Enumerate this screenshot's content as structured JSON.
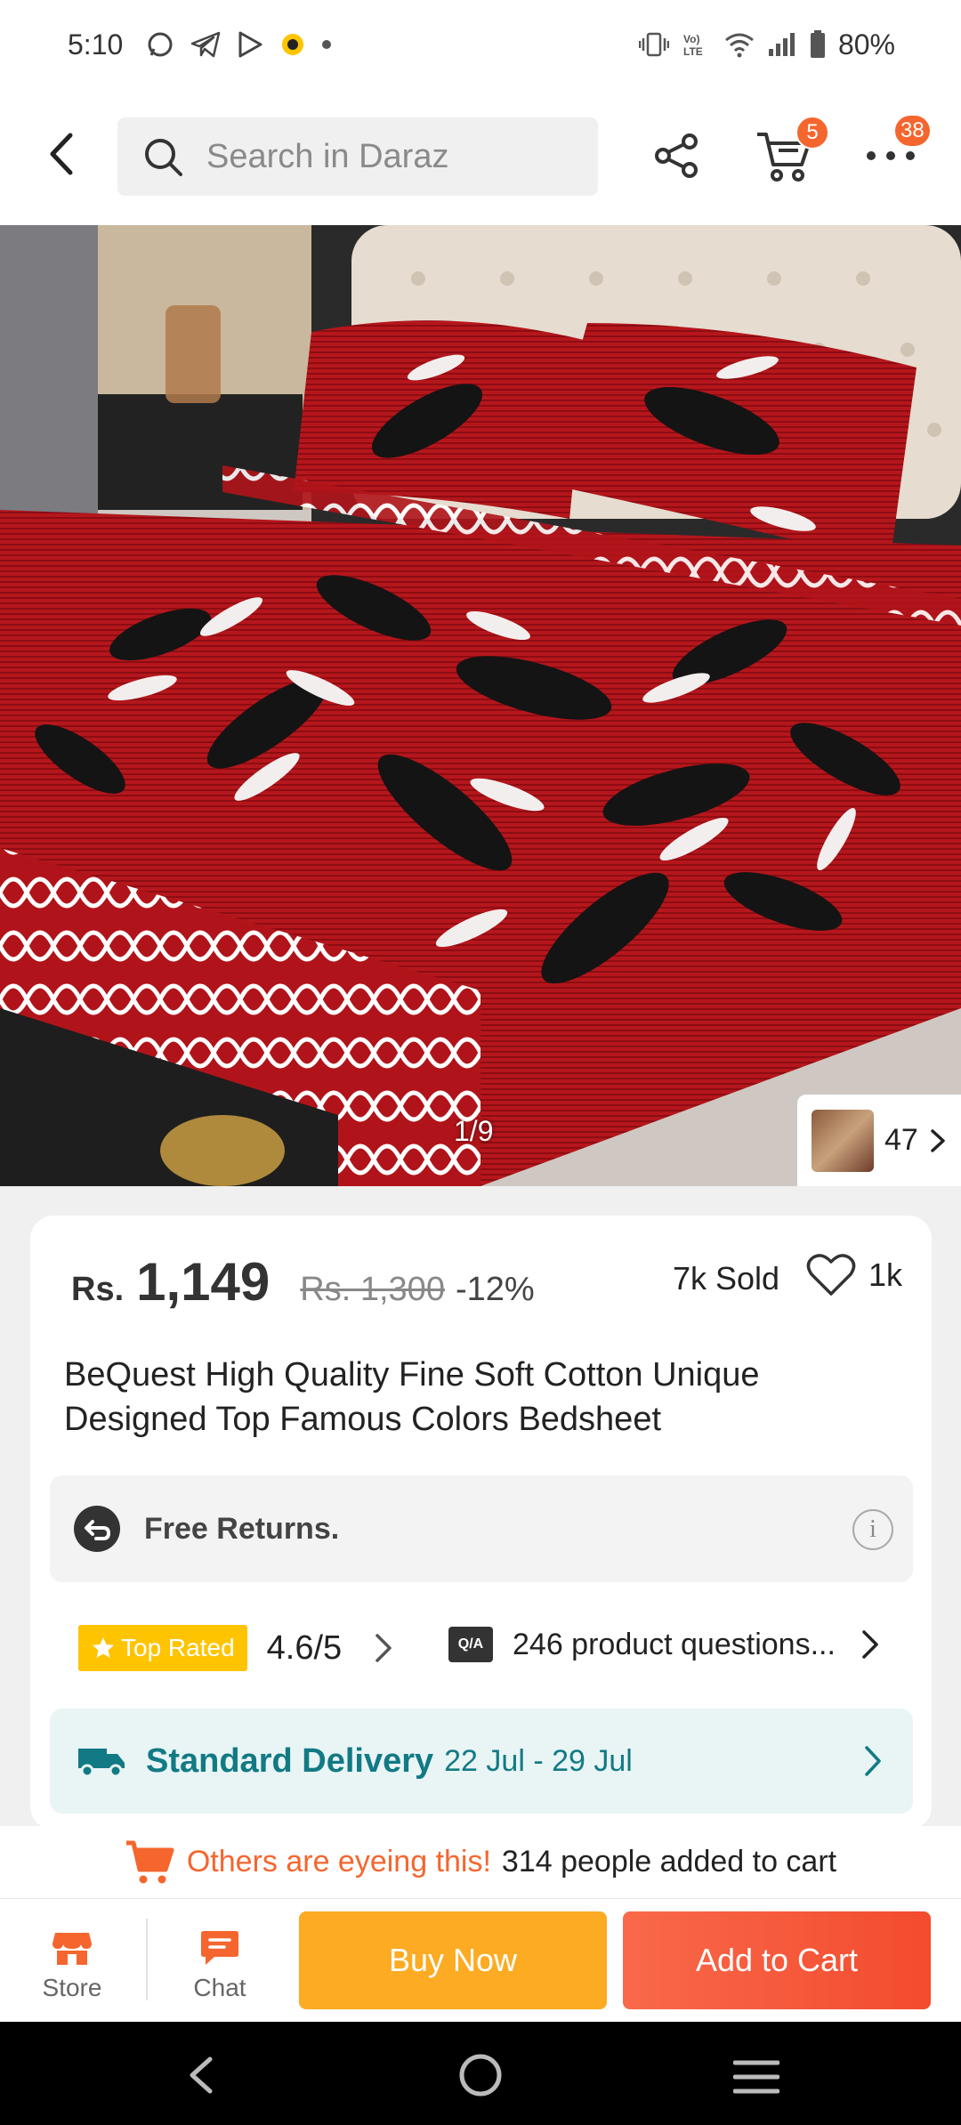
{
  "status_bar": {
    "time": "5:10",
    "battery": "80%",
    "left_icons": [
      "whatsapp-icon",
      "telegram-icon",
      "play-icon",
      "app-icon"
    ],
    "right_icons": [
      "vibrate-icon",
      "volte-icon",
      "wifi-icon",
      "signal-icon",
      "battery-icon"
    ]
  },
  "header": {
    "search_placeholder": "Search in Daraz",
    "cart_badge": "5",
    "more_badge": "38"
  },
  "gallery": {
    "counter": "1/9",
    "review_count": "47"
  },
  "product": {
    "currency": "Rs.",
    "price": "1,149",
    "old_price": "Rs. 1,300",
    "discount": "-12%",
    "sold": "7k Sold",
    "wishlist_count": "1k",
    "title": "BeQuest High Quality Fine Soft Cotton Unique Designed Top Famous Colors  Bedsheet"
  },
  "returns": {
    "label": "Free Returns."
  },
  "rating": {
    "badge": "Top Rated",
    "value": "4.6/5",
    "qa_icon": "Q/A",
    "questions": "246 product questions..."
  },
  "delivery": {
    "label": "Standard Delivery",
    "dates": "22 Jul - 29 Jul"
  },
  "eyeing": {
    "highlight": "Others are eyeing this!",
    "text": "314 people added to cart"
  },
  "actions": {
    "store_label": "Store",
    "chat_label": "Chat",
    "buy_now": "Buy Now",
    "add_to_cart": "Add to Cart"
  },
  "colors": {
    "brand_orange": "#f5662e",
    "buy_now_bg": "#fcab23",
    "delivery_teal": "#117a84",
    "top_rated_bg": "#ffc400"
  }
}
